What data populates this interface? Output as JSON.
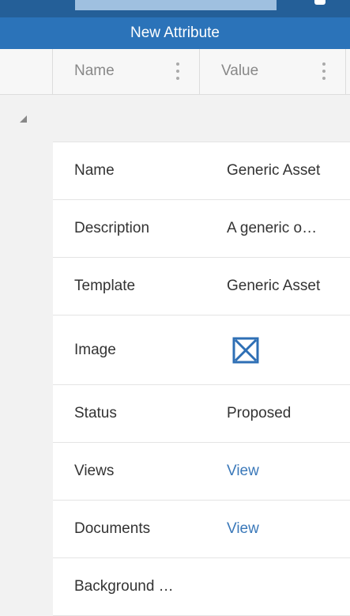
{
  "toolbar": {
    "new_attribute_label": "New Attribute"
  },
  "grid": {
    "columns": [
      {
        "label": "Name"
      },
      {
        "label": "Value"
      }
    ],
    "rows": [
      {
        "name": "Name",
        "value": "Generic Asset"
      },
      {
        "name": "Description",
        "value": "A generic o…"
      },
      {
        "name": "Template",
        "value": "Generic Asset"
      },
      {
        "name": "Image",
        "value": "",
        "icon": "broken-image-icon"
      },
      {
        "name": "Status",
        "value": "Proposed"
      },
      {
        "name": "Views",
        "value": "View"
      },
      {
        "name": "Documents",
        "value": "View"
      },
      {
        "name": "Background …",
        "value": ""
      }
    ]
  },
  "colors": {
    "header_blue": "#2b73b9",
    "link_blue": "#3a78b9"
  }
}
